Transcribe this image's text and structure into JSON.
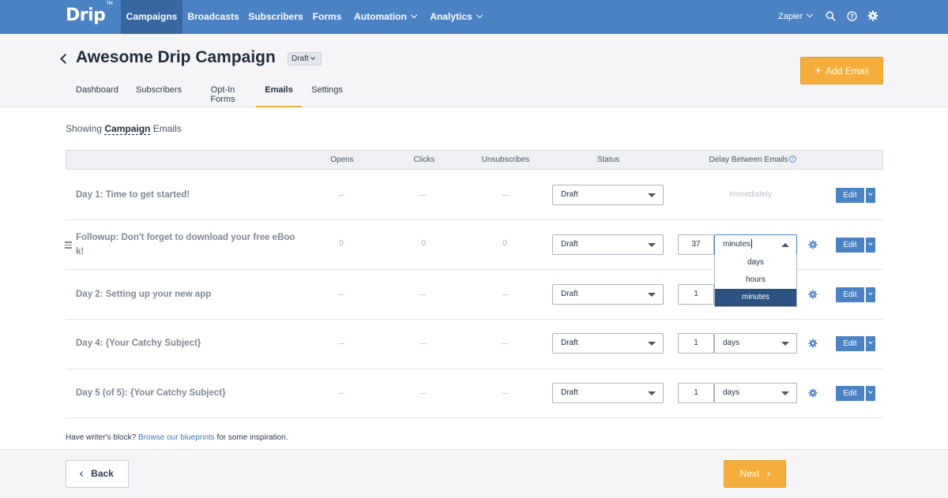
{
  "brand": {
    "logo": "Drip",
    "tm": "TM",
    "accent": "#4a82c4",
    "orange": "#f5ae3b"
  },
  "nav": {
    "items": [
      "Campaigns",
      "Broadcasts",
      "Subscribers",
      "Forms",
      "Automation",
      "Analytics"
    ],
    "account": "Zapier",
    "icons": [
      "search-icon",
      "help-icon",
      "gear-icon"
    ]
  },
  "header": {
    "title": "Awesome Drip Campaign",
    "status_badge": "Draft",
    "add_email": "Add Email",
    "tabs": [
      "Dashboard",
      "Subscribers",
      "Opt-In Forms",
      "Emails",
      "Settings"
    ],
    "active_tab": "Emails"
  },
  "showing": {
    "prefix": "Showing",
    "value": "Campaign",
    "suffix": "Emails"
  },
  "table": {
    "columns": [
      "Opens",
      "Clicks",
      "Unsubscribes",
      "Status",
      "Delay Between Emails"
    ],
    "rows": [
      {
        "subject": "Day 1: Time to get started!",
        "opens": "",
        "clicks": "",
        "unsubscribes": "",
        "status": "Draft",
        "delay_text": "Immediately",
        "edit": "Edit"
      },
      {
        "subject_line1": "Followup: Don't forget to download your free eBoo",
        "subject_line2": "k!",
        "opens": "0",
        "clicks": "0",
        "unsubscribes": "0",
        "status": "Draft",
        "delay_value": "37",
        "delay_unit": "minutes",
        "edit": "Edit"
      },
      {
        "subject": "Day 2: Setting up your new app",
        "opens": "",
        "clicks": "",
        "unsubscribes": "",
        "status": "Draft",
        "delay_value": "1",
        "edit": "Edit"
      },
      {
        "subject": "Day 4: {Your Catchy Subject}",
        "opens": "",
        "clicks": "",
        "unsubscribes": "",
        "status": "Draft",
        "delay_value": "1",
        "delay_unit": "days",
        "edit": "Edit"
      },
      {
        "subject": "Day 5 (of 5): {Your Catchy Subject}",
        "opens": "",
        "clicks": "",
        "unsubscribes": "",
        "status": "Draft",
        "delay_value": "1",
        "delay_unit": "days",
        "edit": "Edit"
      }
    ],
    "unit_dropdown": {
      "options": [
        "days",
        "hours",
        "minutes"
      ],
      "selected": "minutes"
    }
  },
  "blueprint": {
    "prefix": "Have writer's block?",
    "link": "Browse our blueprints",
    "suffix": "for some inspiration."
  },
  "footer": {
    "back": "Back",
    "next": "Next"
  }
}
